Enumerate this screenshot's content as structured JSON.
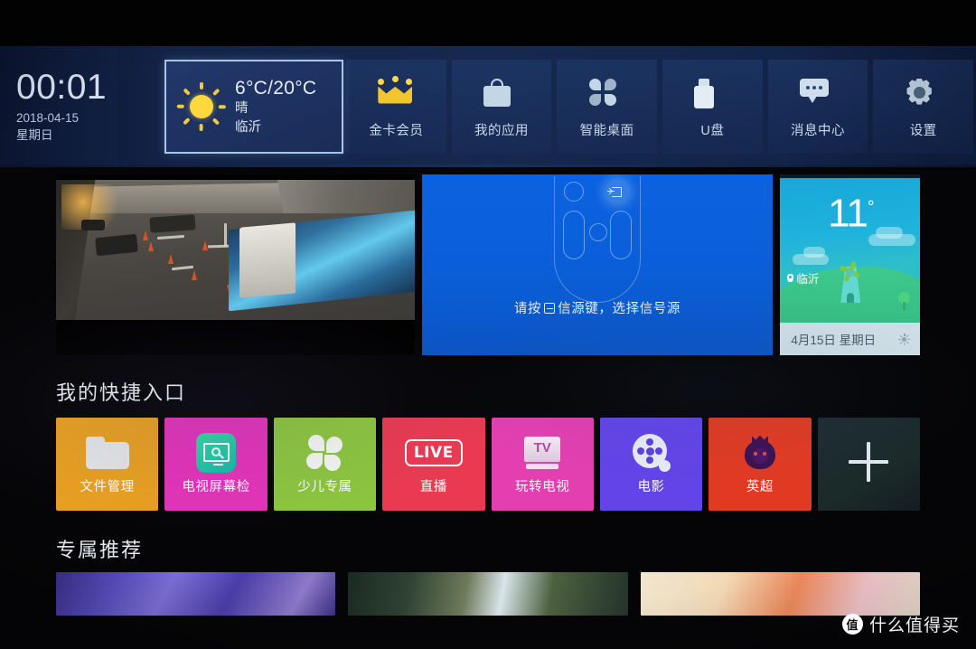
{
  "statusbar": {
    "clock": {
      "time": "00:01",
      "date": "2018-04-15",
      "weekday": "星期日"
    },
    "weather_focus": {
      "icon": "sun-icon",
      "temperature": "6°C/20°C",
      "condition": "晴",
      "city": "临沂",
      "focused": true
    },
    "nav_items": [
      {
        "icon": "crown-icon",
        "label": "金卡会员"
      },
      {
        "icon": "bag-icon",
        "label": "我的应用"
      },
      {
        "icon": "quad-icon",
        "label": "智能桌面"
      },
      {
        "icon": "usb-icon",
        "label": "U盘"
      },
      {
        "icon": "message-icon",
        "label": "消息中心"
      },
      {
        "icon": "gear-icon",
        "label": "设置"
      }
    ]
  },
  "hero": {
    "video_card": {
      "name": "video-preview"
    },
    "source_card": {
      "hint_prefix": "请按",
      "hint_suffix": "信源键，选择信号源",
      "button_icon": "source-input-icon"
    },
    "weather_card": {
      "temperature": "11",
      "degree": "°",
      "location": "临沂",
      "date": "4月15日 星期日",
      "condition_icon": "sun-icon"
    }
  },
  "sections": {
    "shortcuts_title": "我的快捷入口",
    "recommend_title": "专属推荐"
  },
  "shortcuts": [
    {
      "label": "文件管理",
      "icon": "folder-icon",
      "color": "#e8a020"
    },
    {
      "label": "电视屏幕检",
      "icon": "screen-search-icon",
      "color": "#e333b8"
    },
    {
      "label": "少儿专属",
      "icon": "pinwheel-icon",
      "color": "#8cc63e"
    },
    {
      "label": "直播",
      "icon": "live-badge-icon",
      "color": "#ea3a52"
    },
    {
      "label": "玩转电视",
      "icon": "tv-book-icon",
      "color": "#e33fb0"
    },
    {
      "label": "电影",
      "icon": "film-reel-icon",
      "color": "#6344e8"
    },
    {
      "label": "英超",
      "icon": "lion-icon",
      "color": "#e13a22"
    },
    {
      "label": "",
      "icon": "plus-icon",
      "color": "#1e2430"
    }
  ],
  "recommendations": [
    {
      "name": "recommend-thumb-1"
    },
    {
      "name": "recommend-thumb-2"
    },
    {
      "name": "recommend-thumb-3"
    }
  ],
  "watermark": {
    "badge": "值",
    "text": "什么值得买"
  }
}
